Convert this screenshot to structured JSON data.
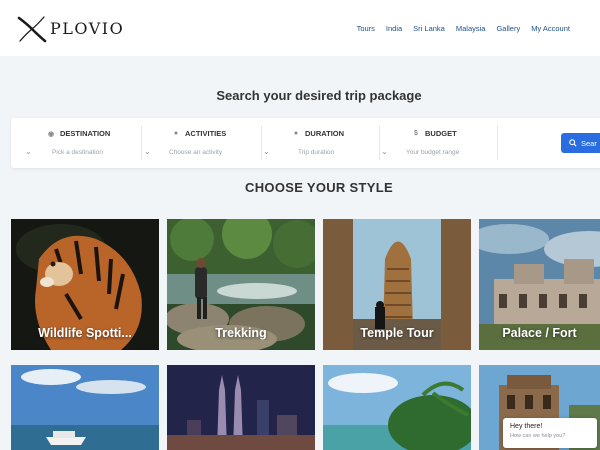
{
  "brand": {
    "logo_text": "PLOVIO"
  },
  "nav": [
    "Tours",
    "India",
    "Sri Lanka",
    "Malaysia",
    "Gallery",
    "My Account"
  ],
  "search": {
    "heading": "Search your desired trip package",
    "fields": [
      {
        "label": "DESTINATION",
        "icon": "map-pin-icon",
        "placeholder": "Pick a destination"
      },
      {
        "label": "ACTIVITIES",
        "icon": "activity-icon",
        "placeholder": "Choose an activity"
      },
      {
        "label": "DURATION",
        "icon": "clock-icon",
        "placeholder": "Trip duration"
      },
      {
        "label": "BUDGET",
        "icon": "dollar-icon",
        "placeholder": "Your budget range"
      }
    ],
    "button_label": "Sear"
  },
  "style_heading": "CHOOSE YOUR STYLE",
  "cards": [
    {
      "label": "Wildlife Spotti..."
    },
    {
      "label": "Trekking"
    },
    {
      "label": "Temple Tour"
    },
    {
      "label": "Palace / Fort"
    },
    {
      "label": ""
    },
    {
      "label": ""
    },
    {
      "label": ""
    },
    {
      "label": ""
    }
  ],
  "chat": {
    "title": "Hey there!",
    "subtitle": "How can we help you?"
  },
  "colors": {
    "accent": "#2a6de0",
    "nav_link": "#1d4f8f",
    "background": "#f1f5f8"
  }
}
